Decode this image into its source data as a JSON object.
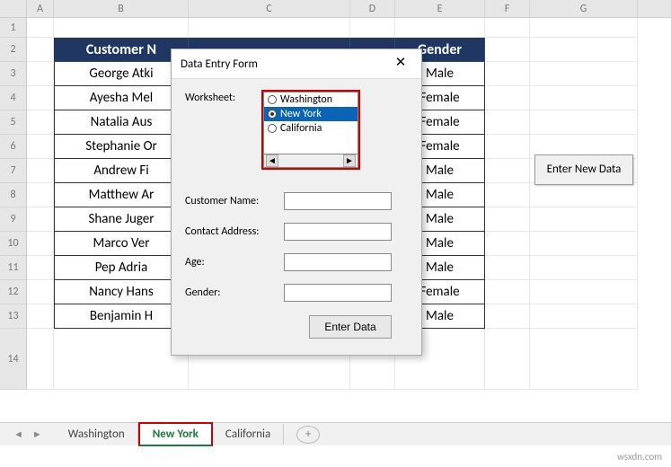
{
  "columns": [
    "A",
    "B",
    "C",
    "D",
    "E",
    "F",
    "G"
  ],
  "row_numbers": [
    "1",
    "2",
    "3",
    "4",
    "5",
    "6",
    "7",
    "8",
    "9",
    "10",
    "11",
    "12",
    "13",
    "14"
  ],
  "headers": {
    "name": "Customer N",
    "gender": "Gender"
  },
  "rows": [
    {
      "name": "George Atki",
      "gender": "Male"
    },
    {
      "name": "Ayesha Mel",
      "gender": "Female"
    },
    {
      "name": "Natalia Aus",
      "gender": "Female"
    },
    {
      "name": "Stephanie Or",
      "gender": "Female"
    },
    {
      "name": "Andrew Fi",
      "gender": "Male"
    },
    {
      "name": "Matthew Ar",
      "gender": "Male"
    },
    {
      "name": "Shane Juger",
      "gender": "Male"
    },
    {
      "name": "Marco Ver",
      "gender": "Male"
    },
    {
      "name": "Pep Adria",
      "gender": "Male"
    },
    {
      "name": "Nancy Hans",
      "gender": "Female"
    },
    {
      "name": "Benjamin H",
      "gender": "Male"
    }
  ],
  "side_button": "Enter New Data",
  "dialog": {
    "title": "Data Entry Form",
    "worksheet_label": "Worksheet:",
    "options": {
      "a": "Washington",
      "b": "New York",
      "c": "California"
    },
    "fields": {
      "customer": "Customer Name:",
      "address": "Contact Address:",
      "age": "Age:",
      "gender": "Gender:"
    },
    "submit": "Enter Data"
  },
  "tabs": {
    "a": "Washington",
    "b": "New York",
    "c": "California"
  },
  "watermark": "wsxdn.com"
}
